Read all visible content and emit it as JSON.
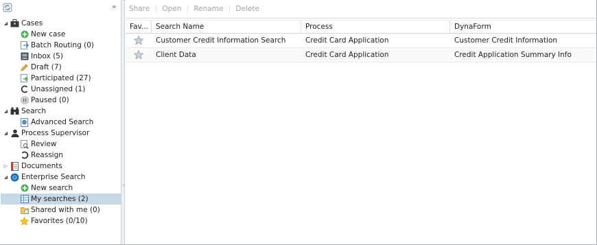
{
  "toolbar": {
    "share": "Share",
    "open": "Open",
    "rename": "Rename",
    "delete": "Delete"
  },
  "tree": {
    "cases": "Cases",
    "new_case": "New case",
    "batch_routing": "Batch Routing (0)",
    "inbox": "Inbox (5)",
    "draft": "Draft (7)",
    "participated": "Participated (27)",
    "unassigned": "Unassigned (1)",
    "paused": "Paused (0)",
    "search": "Search",
    "advanced_search": "Advanced Search",
    "process_supervisor": "Process Supervisor",
    "review": "Review",
    "reassign": "Reassign",
    "documents": "Documents",
    "enterprise_search": "Enterprise Search",
    "new_search": "New search",
    "my_searches": "My searches (2)",
    "shared_with_me": "Shared with me (0)",
    "favorites": "Favorites (0/10)"
  },
  "grid": {
    "columns": [
      "Fav...",
      "Search Name",
      "Process",
      "DynaForm"
    ],
    "rows": [
      {
        "name": "Customer Credit Information Search",
        "process": "Credit Card Application",
        "dynaform": "Customer Credit Information"
      },
      {
        "name": "Client Data",
        "process": "Credit Card Application",
        "dynaform": "Credit Application Summary Info"
      }
    ]
  },
  "colors": {
    "selected": "#c7d9e6",
    "border": "#a9b4bf",
    "toolbar_text": "#a3a3a3"
  }
}
